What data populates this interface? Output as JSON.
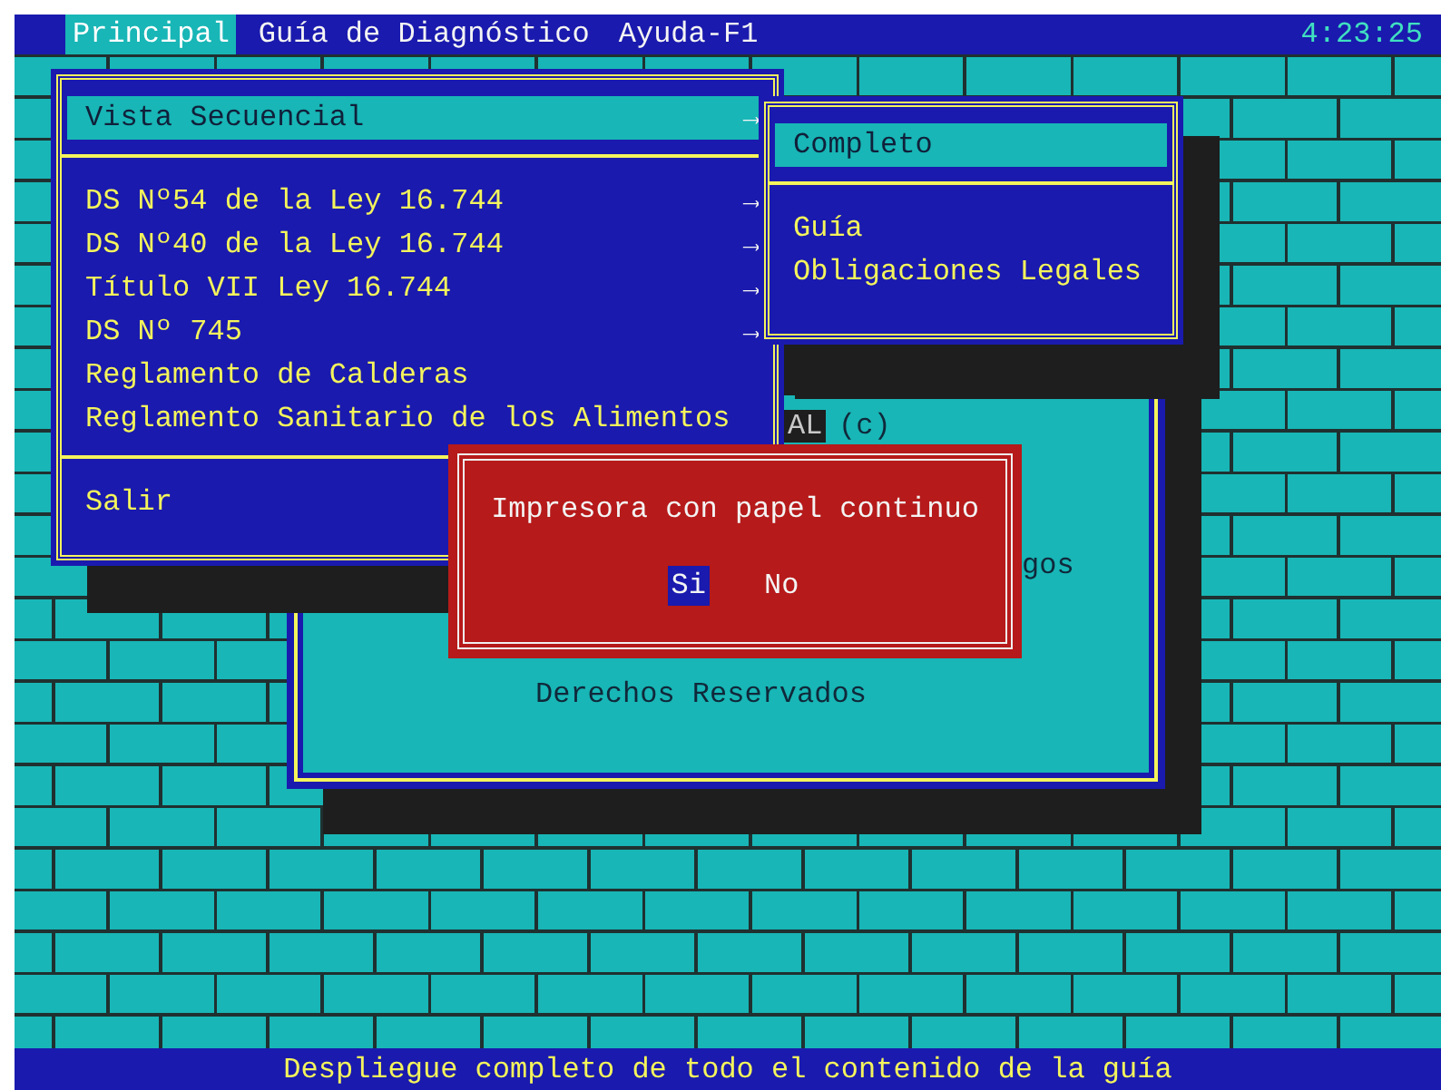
{
  "menu_bar": {
    "items": [
      {
        "label": "Principal",
        "selected": true
      },
      {
        "label": "Guía de Diagnóstico",
        "selected": false
      },
      {
        "label": "Ayuda-F1",
        "selected": false
      }
    ],
    "clock": "4:23:25"
  },
  "main_menu": {
    "sections": [
      {
        "items": [
          {
            "label": "Vista Secuencial",
            "arrow": "→",
            "selected": true
          }
        ]
      },
      {
        "items": [
          {
            "label": "DS Nº54 de la Ley 16.744",
            "arrow": "→",
            "selected": false
          },
          {
            "label": "DS Nº40 de la Ley 16.744",
            "arrow": "→",
            "selected": false
          },
          {
            "label": "Título VII Ley 16.744",
            "arrow": "→",
            "selected": false
          },
          {
            "label": "DS Nº 745",
            "arrow": "→",
            "selected": false
          },
          {
            "label": "Reglamento de Calderas",
            "selected": false
          },
          {
            "label": "Reglamento Sanitario de los Alimentos",
            "selected": false
          }
        ]
      },
      {
        "items": [
          {
            "label": "Salir",
            "selected": false
          }
        ]
      }
    ]
  },
  "submenu": {
    "sections": [
      {
        "items": [
          {
            "label": "Completo",
            "selected": true
          }
        ]
      },
      {
        "items": [
          {
            "label": "Guía",
            "selected": false
          },
          {
            "label": "Obligaciones Legales",
            "selected": false
          }
        ]
      }
    ]
  },
  "about_window": {
    "fragment": "AL",
    "copyright": "(c)",
    "cut_text": "gos",
    "rights": "Derechos Reservados"
  },
  "dialog": {
    "message": "Impresora con papel continuo",
    "buttons": [
      {
        "label": "Si",
        "selected": true
      },
      {
        "label": "No",
        "selected": false
      }
    ]
  },
  "status_bar": "Despliegue completo de todo el contenido de la guía"
}
